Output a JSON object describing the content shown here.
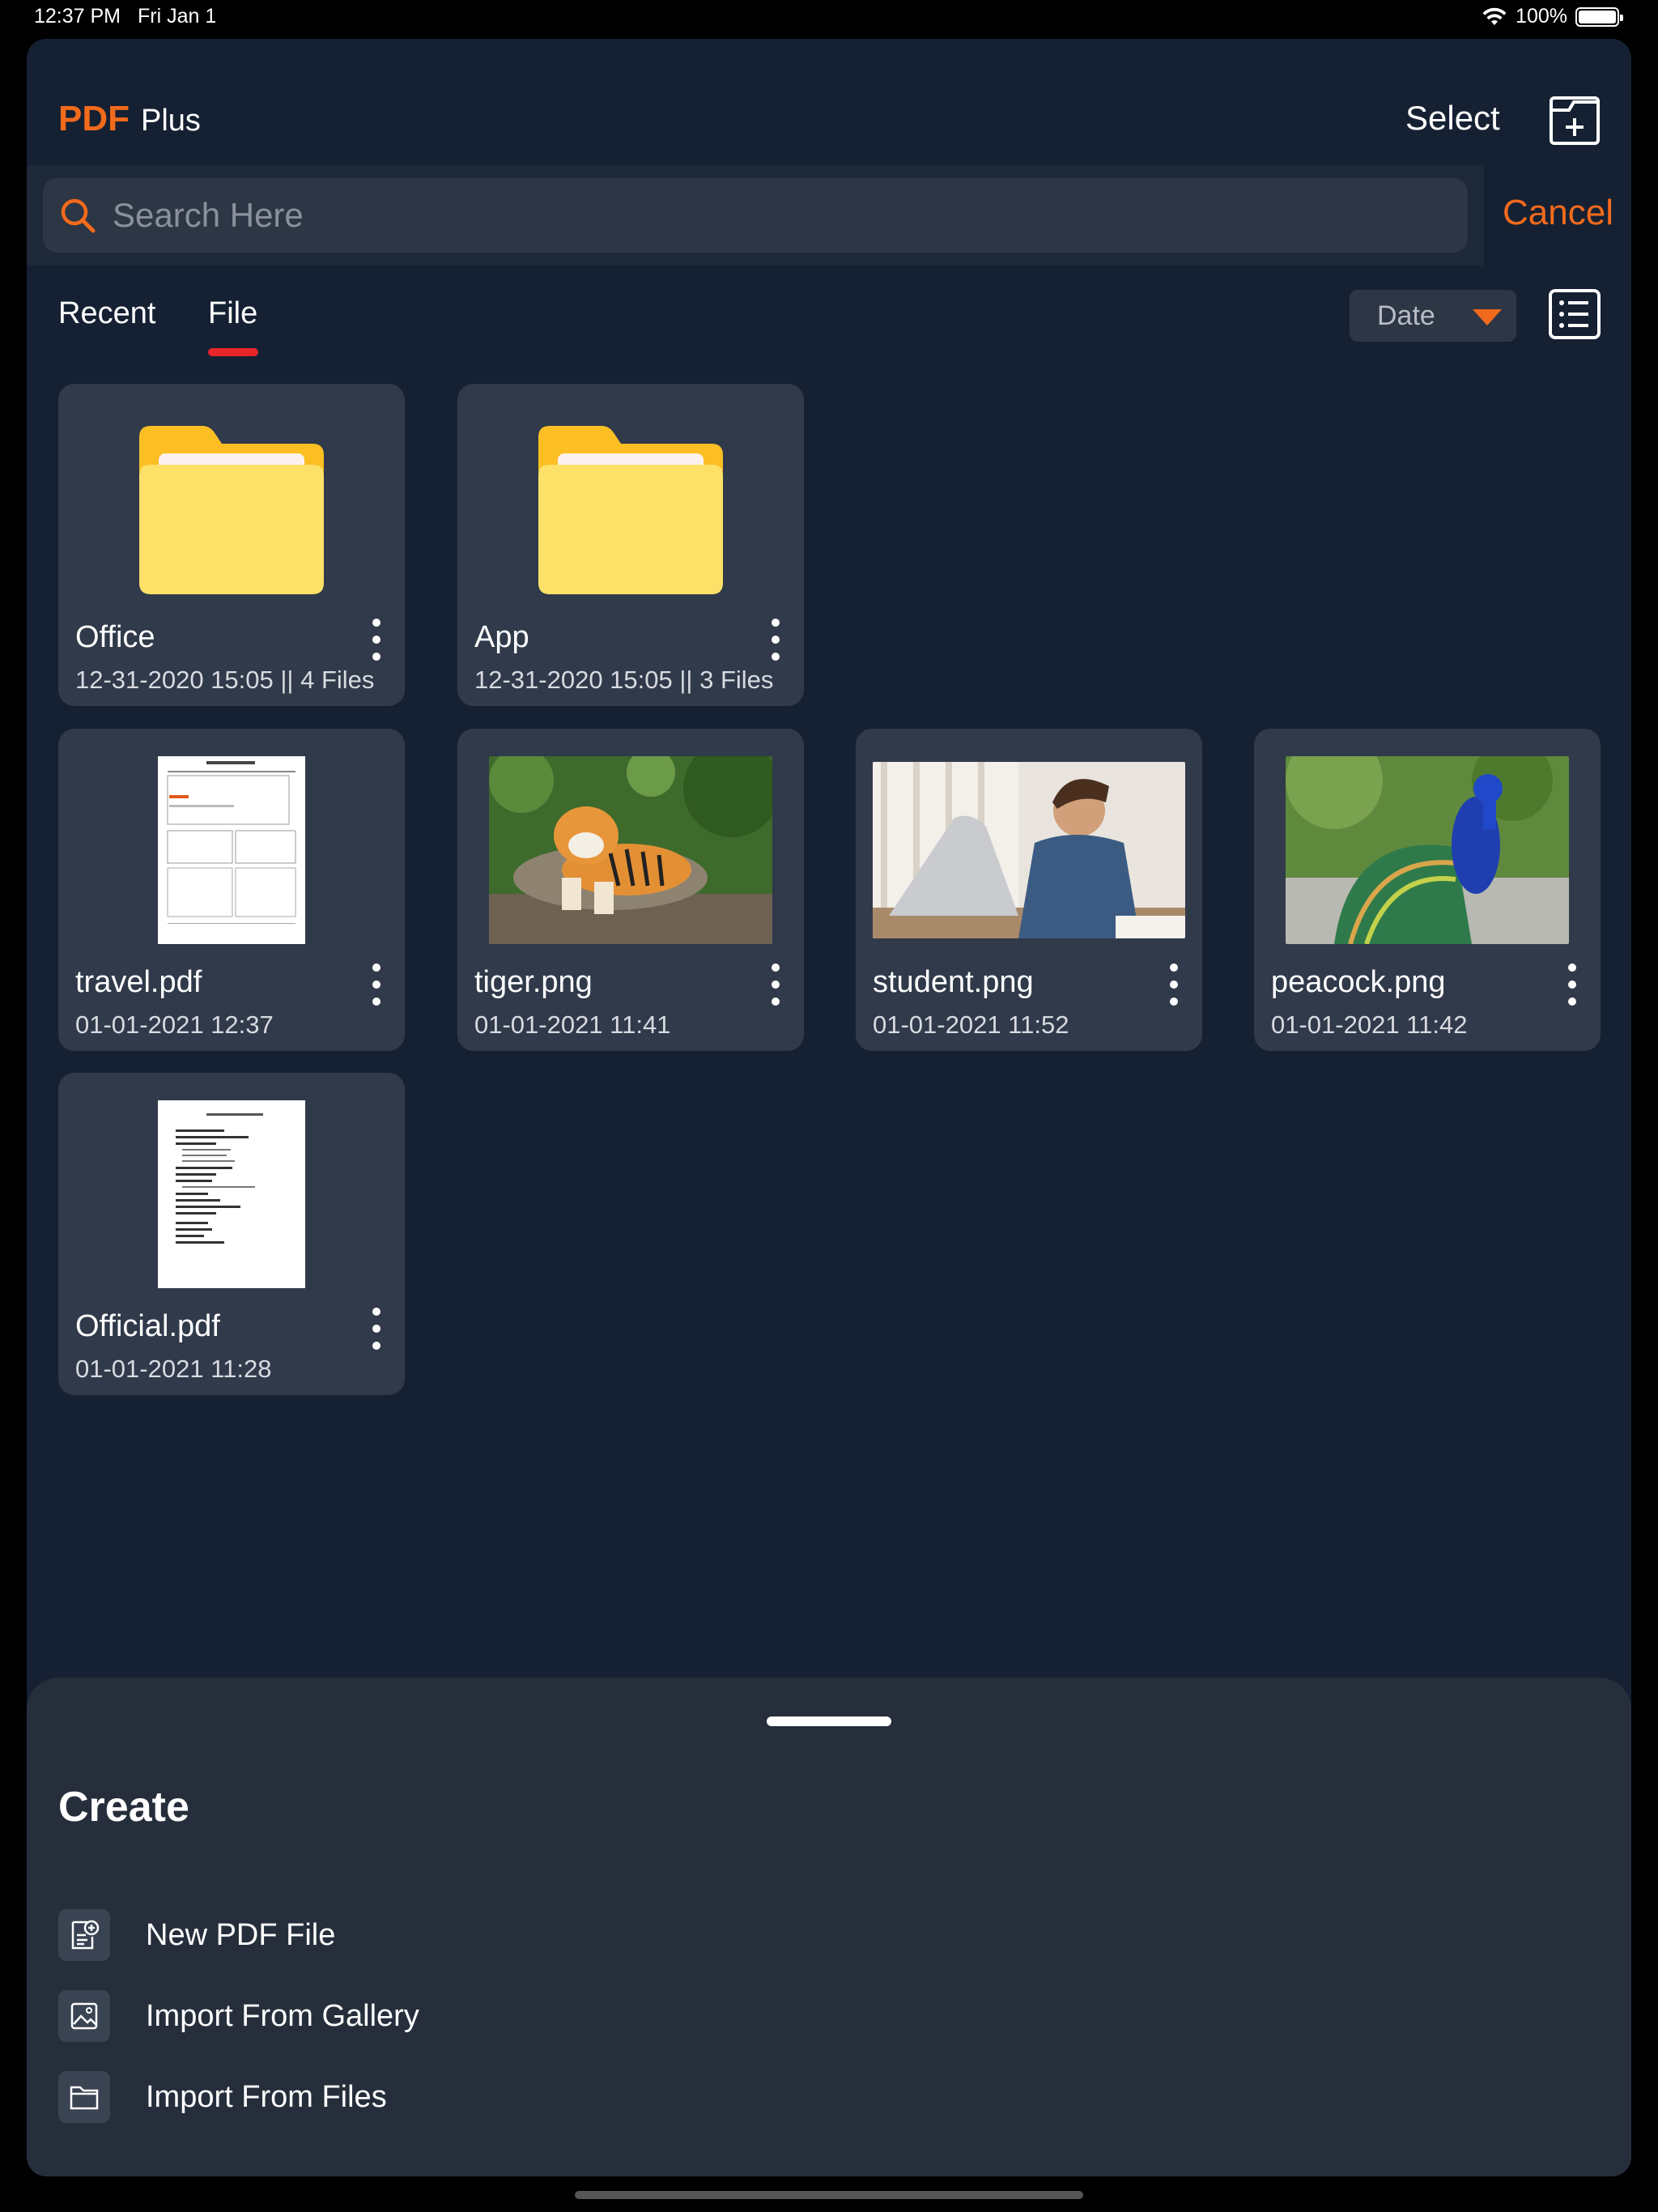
{
  "status_bar": {
    "time": "12:37 PM",
    "date": "Fri Jan 1",
    "battery": "100%"
  },
  "header": {
    "logo_pdf": "PDF",
    "logo_plus": "Plus",
    "select_label": "Select",
    "new_folder_icon": "new-folder-icon"
  },
  "search": {
    "placeholder": "Search Here",
    "value": "",
    "cancel_label": "Cancel"
  },
  "tabs": [
    {
      "label": "Recent",
      "active": false
    },
    {
      "label": "File",
      "active": true
    }
  ],
  "sort": {
    "label": "Date"
  },
  "colors": {
    "accent": "#f26a1b",
    "tab_underline": "#e8262a",
    "background": "#152133",
    "card": "#303a4a"
  },
  "items": [
    {
      "type": "folder",
      "name": "Office",
      "meta": "12-31-2020 15:05 || 4 Files"
    },
    {
      "type": "folder",
      "name": "App",
      "meta": "12-31-2020 15:05 || 3 Files"
    },
    {
      "type": "pdf",
      "name": "travel.pdf",
      "meta": "01-01-2021 12:37"
    },
    {
      "type": "image",
      "name": "tiger.png",
      "meta": "01-01-2021 11:41"
    },
    {
      "type": "image",
      "name": "student.png",
      "meta": "01-01-2021 11:52"
    },
    {
      "type": "image",
      "name": "peacock.png",
      "meta": "01-01-2021 11:42"
    },
    {
      "type": "pdf",
      "name": "Official.pdf",
      "meta": "01-01-2021 11:28"
    }
  ],
  "create": {
    "title": "Create",
    "options": [
      {
        "label": "New PDF File",
        "icon": "new-pdf-icon"
      },
      {
        "label": "Import From Gallery",
        "icon": "gallery-icon"
      },
      {
        "label": "Import From Files",
        "icon": "folder-icon"
      }
    ]
  }
}
